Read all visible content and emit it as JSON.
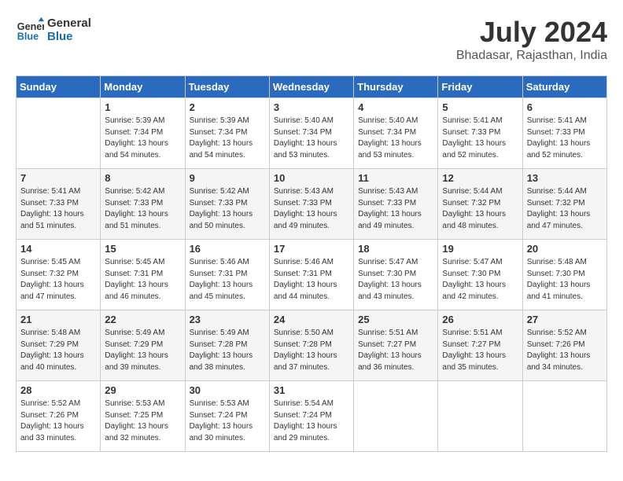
{
  "header": {
    "logo_line1": "General",
    "logo_line2": "Blue",
    "month_year": "July 2024",
    "location": "Bhadasar, Rajasthan, India"
  },
  "weekdays": [
    "Sunday",
    "Monday",
    "Tuesday",
    "Wednesday",
    "Thursday",
    "Friday",
    "Saturday"
  ],
  "weeks": [
    [
      {
        "day": "",
        "sunrise": "",
        "sunset": "",
        "daylight": ""
      },
      {
        "day": "1",
        "sunrise": "5:39 AM",
        "sunset": "7:34 PM",
        "daylight": "13 hours and 54 minutes."
      },
      {
        "day": "2",
        "sunrise": "5:39 AM",
        "sunset": "7:34 PM",
        "daylight": "13 hours and 54 minutes."
      },
      {
        "day": "3",
        "sunrise": "5:40 AM",
        "sunset": "7:34 PM",
        "daylight": "13 hours and 53 minutes."
      },
      {
        "day": "4",
        "sunrise": "5:40 AM",
        "sunset": "7:34 PM",
        "daylight": "13 hours and 53 minutes."
      },
      {
        "day": "5",
        "sunrise": "5:41 AM",
        "sunset": "7:33 PM",
        "daylight": "13 hours and 52 minutes."
      },
      {
        "day": "6",
        "sunrise": "5:41 AM",
        "sunset": "7:33 PM",
        "daylight": "13 hours and 52 minutes."
      }
    ],
    [
      {
        "day": "7",
        "sunrise": "5:41 AM",
        "sunset": "7:33 PM",
        "daylight": "13 hours and 51 minutes."
      },
      {
        "day": "8",
        "sunrise": "5:42 AM",
        "sunset": "7:33 PM",
        "daylight": "13 hours and 51 minutes."
      },
      {
        "day": "9",
        "sunrise": "5:42 AM",
        "sunset": "7:33 PM",
        "daylight": "13 hours and 50 minutes."
      },
      {
        "day": "10",
        "sunrise": "5:43 AM",
        "sunset": "7:33 PM",
        "daylight": "13 hours and 49 minutes."
      },
      {
        "day": "11",
        "sunrise": "5:43 AM",
        "sunset": "7:33 PM",
        "daylight": "13 hours and 49 minutes."
      },
      {
        "day": "12",
        "sunrise": "5:44 AM",
        "sunset": "7:32 PM",
        "daylight": "13 hours and 48 minutes."
      },
      {
        "day": "13",
        "sunrise": "5:44 AM",
        "sunset": "7:32 PM",
        "daylight": "13 hours and 47 minutes."
      }
    ],
    [
      {
        "day": "14",
        "sunrise": "5:45 AM",
        "sunset": "7:32 PM",
        "daylight": "13 hours and 47 minutes."
      },
      {
        "day": "15",
        "sunrise": "5:45 AM",
        "sunset": "7:31 PM",
        "daylight": "13 hours and 46 minutes."
      },
      {
        "day": "16",
        "sunrise": "5:46 AM",
        "sunset": "7:31 PM",
        "daylight": "13 hours and 45 minutes."
      },
      {
        "day": "17",
        "sunrise": "5:46 AM",
        "sunset": "7:31 PM",
        "daylight": "13 hours and 44 minutes."
      },
      {
        "day": "18",
        "sunrise": "5:47 AM",
        "sunset": "7:30 PM",
        "daylight": "13 hours and 43 minutes."
      },
      {
        "day": "19",
        "sunrise": "5:47 AM",
        "sunset": "7:30 PM",
        "daylight": "13 hours and 42 minutes."
      },
      {
        "day": "20",
        "sunrise": "5:48 AM",
        "sunset": "7:30 PM",
        "daylight": "13 hours and 41 minutes."
      }
    ],
    [
      {
        "day": "21",
        "sunrise": "5:48 AM",
        "sunset": "7:29 PM",
        "daylight": "13 hours and 40 minutes."
      },
      {
        "day": "22",
        "sunrise": "5:49 AM",
        "sunset": "7:29 PM",
        "daylight": "13 hours and 39 minutes."
      },
      {
        "day": "23",
        "sunrise": "5:49 AM",
        "sunset": "7:28 PM",
        "daylight": "13 hours and 38 minutes."
      },
      {
        "day": "24",
        "sunrise": "5:50 AM",
        "sunset": "7:28 PM",
        "daylight": "13 hours and 37 minutes."
      },
      {
        "day": "25",
        "sunrise": "5:51 AM",
        "sunset": "7:27 PM",
        "daylight": "13 hours and 36 minutes."
      },
      {
        "day": "26",
        "sunrise": "5:51 AM",
        "sunset": "7:27 PM",
        "daylight": "13 hours and 35 minutes."
      },
      {
        "day": "27",
        "sunrise": "5:52 AM",
        "sunset": "7:26 PM",
        "daylight": "13 hours and 34 minutes."
      }
    ],
    [
      {
        "day": "28",
        "sunrise": "5:52 AM",
        "sunset": "7:26 PM",
        "daylight": "13 hours and 33 minutes."
      },
      {
        "day": "29",
        "sunrise": "5:53 AM",
        "sunset": "7:25 PM",
        "daylight": "13 hours and 32 minutes."
      },
      {
        "day": "30",
        "sunrise": "5:53 AM",
        "sunset": "7:24 PM",
        "daylight": "13 hours and 30 minutes."
      },
      {
        "day": "31",
        "sunrise": "5:54 AM",
        "sunset": "7:24 PM",
        "daylight": "13 hours and 29 minutes."
      },
      {
        "day": "",
        "sunrise": "",
        "sunset": "",
        "daylight": ""
      },
      {
        "day": "",
        "sunrise": "",
        "sunset": "",
        "daylight": ""
      },
      {
        "day": "",
        "sunrise": "",
        "sunset": "",
        "daylight": ""
      }
    ]
  ]
}
